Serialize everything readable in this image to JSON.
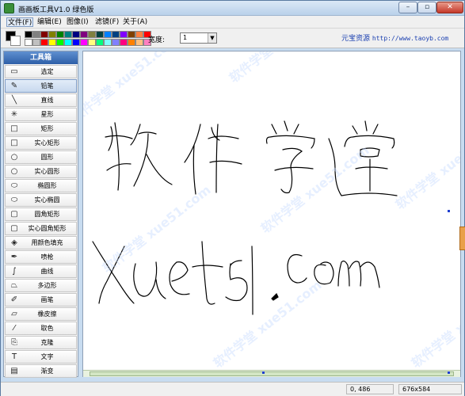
{
  "window": {
    "title": "画画板工具V1.0 绿色版",
    "min": "–",
    "max": "▫",
    "close": "✕"
  },
  "menu": [
    {
      "label": "文件(F)"
    },
    {
      "label": "编辑(E)"
    },
    {
      "label": "图像(I)"
    },
    {
      "label": "滤镜(F)"
    },
    {
      "label": "关于(A)"
    }
  ],
  "toolbar": {
    "palette_row1": [
      "#000000",
      "#808080",
      "#800000",
      "#808000",
      "#008000",
      "#008080",
      "#000080",
      "#800080",
      "#808040",
      "#004040",
      "#0080ff",
      "#004080",
      "#8000ff",
      "#804000",
      "#ff8040",
      "#ff0000"
    ],
    "palette_row2": [
      "#ffffff",
      "#c0c0c0",
      "#ff0000",
      "#ffff00",
      "#00ff00",
      "#00ffff",
      "#0000ff",
      "#ff00ff",
      "#ffff80",
      "#00ff80",
      "#80ffff",
      "#8080ff",
      "#ff0080",
      "#ff8000",
      "#ffc080",
      "#ff80c0"
    ],
    "width_label": "宽度:",
    "width_value": "1",
    "site_name": "元宝资源",
    "site_url": "http://www.taoyb.com"
  },
  "toolbox": {
    "title": "工具箱",
    "tools": [
      {
        "label": "选定",
        "icon": "▭"
      },
      {
        "label": "铅笔",
        "icon": "✎"
      },
      {
        "label": "直线",
        "icon": "╲"
      },
      {
        "label": "星形",
        "icon": "✳"
      },
      {
        "label": "矩形",
        "icon": "□"
      },
      {
        "label": "实心矩形",
        "icon": "□"
      },
      {
        "label": "圆形",
        "icon": "○"
      },
      {
        "label": "实心圆形",
        "icon": "○"
      },
      {
        "label": "椭圆形",
        "icon": "⬭"
      },
      {
        "label": "实心椭圆",
        "icon": "⬭"
      },
      {
        "label": "圆角矩形",
        "icon": "▢"
      },
      {
        "label": "实心圆角矩形",
        "icon": "▢"
      },
      {
        "label": "用颜色填充",
        "icon": "◈"
      },
      {
        "label": "喷枪",
        "icon": "✒"
      },
      {
        "label": "曲线",
        "icon": "∫"
      },
      {
        "label": "多边形",
        "icon": "⏢"
      },
      {
        "label": "画笔",
        "icon": "✐"
      },
      {
        "label": "橡皮擦",
        "icon": "▱"
      },
      {
        "label": "取色",
        "icon": "⁄"
      },
      {
        "label": "克隆",
        "icon": "⎘"
      },
      {
        "label": "文字",
        "icon": "T"
      },
      {
        "label": "渐变",
        "icon": "▤"
      }
    ]
  },
  "statusbar": {
    "coords": "0, 486",
    "size": "676x584"
  },
  "watermark": "软件学堂 xue51.com"
}
